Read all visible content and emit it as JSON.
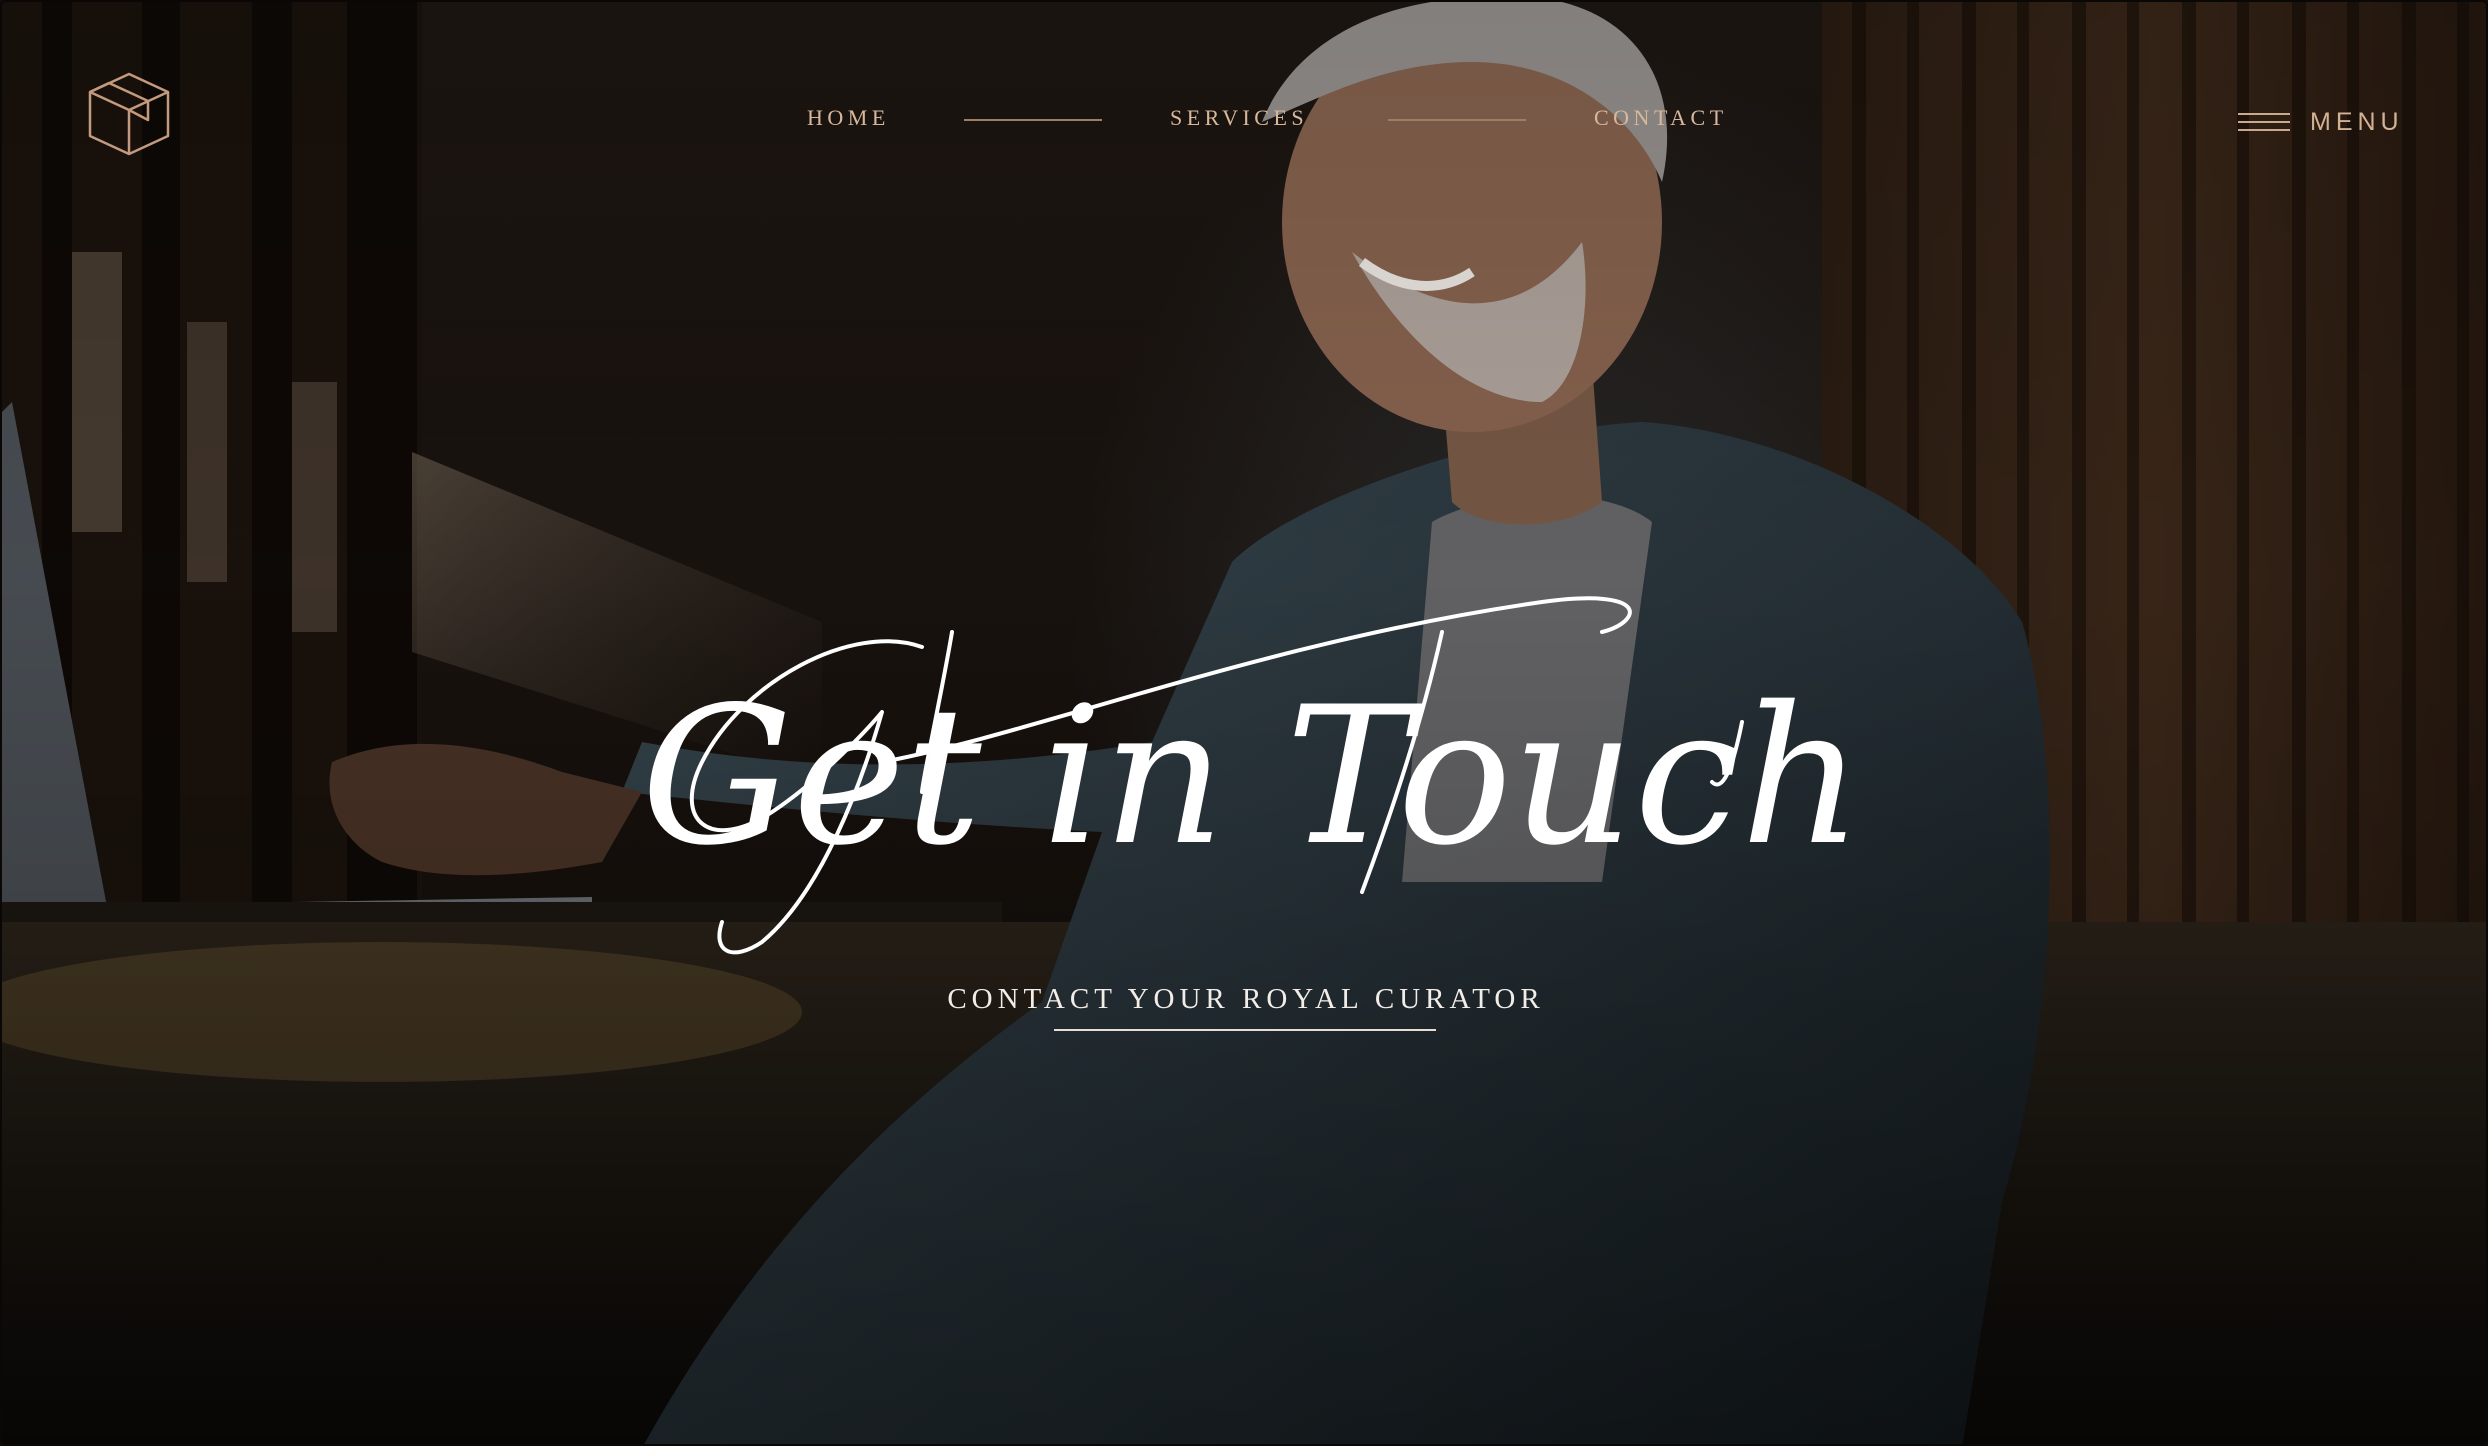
{
  "header": {
    "logo_icon": "box-cube-logo-icon",
    "nav": {
      "home_label": "HOME",
      "services_label": "SERVICES",
      "contact_label": "CONTACT"
    },
    "menu": {
      "icon": "hamburger-icon",
      "label": "MENU"
    }
  },
  "hero": {
    "headline": "Get in Touch",
    "cta_label": "CONTACT YOUR ROYAL CURATOR"
  },
  "colors": {
    "accent_gold": "#d9b89a",
    "headline_white": "#ffffff",
    "background_dark": "#17110d"
  }
}
